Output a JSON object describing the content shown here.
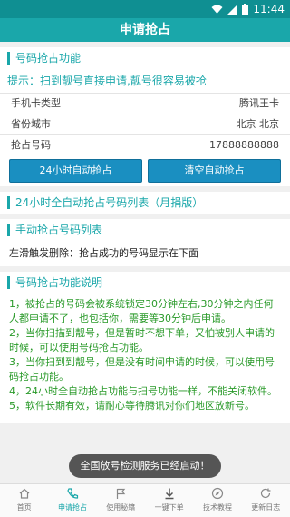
{
  "statusbar": {
    "time": "11:44"
  },
  "title": "申请抢占",
  "section1": {
    "heading": "号码抢占功能",
    "hint": "提示：扫到靓号直接申请,靓号很容易被抢",
    "rows": [
      {
        "label": "手机卡类型",
        "value": "腾讯王卡"
      },
      {
        "label": "省份城市",
        "value": "北京 北京"
      },
      {
        "label": "抢占号码",
        "value": "17888888888"
      }
    ],
    "btn_auto": "24小时自动抢占",
    "btn_clear": "清空自动抢占"
  },
  "section2": {
    "heading": "24小时全自动抢占号码列表（月捐版）"
  },
  "section3": {
    "heading": "手动抢占号码列表",
    "swipe_note": "左滑触发删除：抢占成功的号码显示在下面"
  },
  "section4": {
    "heading": "号码抢占功能说明",
    "lines": [
      "1，被抢占的号码会被系统锁定30分钟左右,30分钟之内任何人都申请不了，也包括你，需要等30分钟后申请。",
      "2，当你扫描到靓号，但是暂时不想下单，又怕被别人申请的时候，可以使用号码抢占功能。",
      "3，当你扫到到靓号，但是没有时间申请的时候，可以使用号码抢占功能。",
      "4，24小时全自动抢占功能与扫号功能一样，不能关闭软件。",
      "5，软件长期有效，请耐心等待腾讯对你们地区放新号。"
    ]
  },
  "toast": "全国放号检测服务已经启动！",
  "tabs": [
    {
      "label": "首页",
      "icon": "home-icon"
    },
    {
      "label": "申请抢占",
      "icon": "phone-icon"
    },
    {
      "label": "使用秘籍",
      "icon": "flag-icon"
    },
    {
      "label": "一键下单",
      "icon": "download-icon"
    },
    {
      "label": "技术教程",
      "icon": "compass-icon"
    },
    {
      "label": "更新日志",
      "icon": "refresh-icon"
    }
  ],
  "colors": {
    "primary": "#1aa7aa",
    "button": "#1a8fc1",
    "desc_green": "#2a9a2a"
  }
}
